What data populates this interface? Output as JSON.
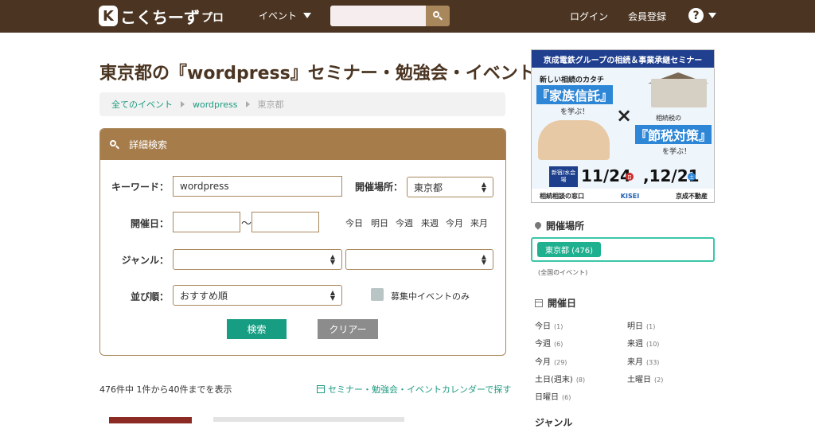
{
  "header": {
    "logo_mark": "K",
    "logo_text": "こくちーず",
    "logo_suffix": "プロ",
    "nav_event": "イベント",
    "search_placeholder": "",
    "login": "ログイン",
    "register": "会員登録",
    "help": "?"
  },
  "page": {
    "title": "東京都の『wordpress』セミナー・勉強会・イベント"
  },
  "breadcrumb": {
    "items": [
      "全てのイベント",
      "wordpress",
      "東京都"
    ]
  },
  "search_panel": {
    "heading": "詳細検索",
    "keyword_label": "キーワード：",
    "keyword_value": "wordpress",
    "place_label": "開催場所：",
    "place_value": "東京都",
    "date_label": "開催日：",
    "date_from": "",
    "date_tilde": "〜",
    "date_to": "",
    "quick_dates": [
      "今日",
      "明日",
      "今週",
      "来週",
      "今月",
      "来月"
    ],
    "genre_label": "ジャンル：",
    "genre1_value": "",
    "genre2_value": "",
    "sort_label": "並び順：",
    "sort_value": "おすすめ順",
    "recruiting_only_label": "募集中イベントのみ",
    "recruiting_only_checked": false,
    "search_button": "検索",
    "clear_button": "クリアー"
  },
  "results": {
    "count_text": "476件中 1件から40件までを表示",
    "calendar_link": "セミナー・勉強会・イベントカレンダーで探す"
  },
  "ad": {
    "top": "京成電鉄グループの相続＆事業承継セミナー",
    "line1": "新しい相続のカタチ",
    "highlight1": "『家族信託』",
    "line1_tail": "を学ぶ！",
    "cross": "×",
    "line2": "相続税の",
    "highlight2": "『節税対策』",
    "line2_tail": "を学ぶ！",
    "badge": "新宿/水会場",
    "date1": "11/24",
    "dow1": "日",
    "date2": ",12/21",
    "dow2": "土",
    "footer_left": "相続相談の窓口",
    "footer_mid": "KISEI",
    "footer_right": "京成不動産"
  },
  "sidebar": {
    "place_heading": "開催場所",
    "place_pill": "東京都 (476)",
    "place_all": "(全国のイベント)",
    "date_heading": "開催日",
    "dates": [
      {
        "label": "今日",
        "count": "(1)"
      },
      {
        "label": "明日",
        "count": "(1)"
      },
      {
        "label": "今週",
        "count": "(6)"
      },
      {
        "label": "来週",
        "count": "(10)"
      },
      {
        "label": "今月",
        "count": "(29)"
      },
      {
        "label": "来月",
        "count": "(33)"
      },
      {
        "label": "土日(週末)",
        "count": "(8)"
      },
      {
        "label": "土曜日",
        "count": "(2)"
      },
      {
        "label": "日曜日",
        "count": "(6)"
      }
    ],
    "next_heading": "ジャンル"
  },
  "colors": {
    "header_bg": "#4b3522",
    "accent_green": "#179d82",
    "panel_brown": "#a67c4b"
  }
}
